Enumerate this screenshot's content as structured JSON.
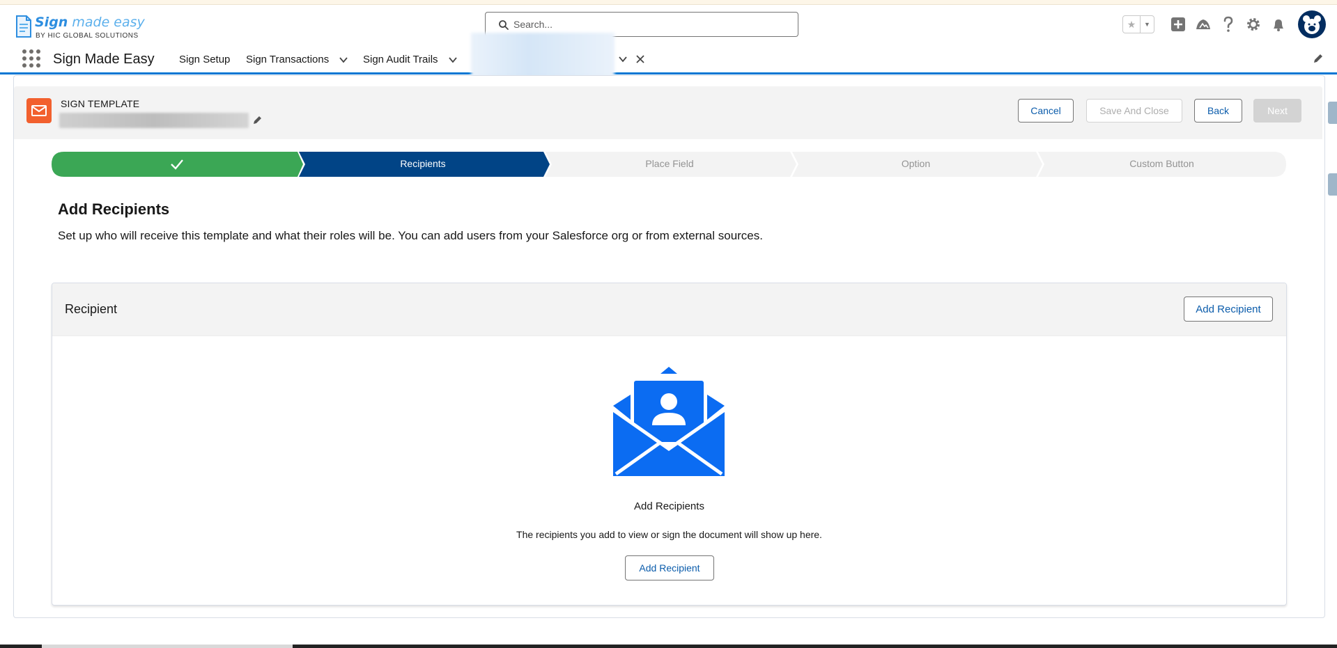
{
  "brand": {
    "logo_main": "Sign",
    "logo_main_rest": " made easy",
    "logo_sub": "BY HIC GLOBAL SOLUTIONS",
    "accent": "#0176d3"
  },
  "search": {
    "placeholder": "Search..."
  },
  "header_icons": [
    "star-icon",
    "chevron-down-icon",
    "add-icon",
    "trailhead-icon",
    "help-icon",
    "gear-icon",
    "bell-icon",
    "avatar"
  ],
  "nav": {
    "app_name": "Sign Made Easy",
    "items": [
      {
        "label": "Sign Setup"
      },
      {
        "label": "Sign Transactions"
      },
      {
        "label": "Sign Audit Trails"
      }
    ]
  },
  "record": {
    "object_label": "SIGN TEMPLATE",
    "icon_color": "#f2602e"
  },
  "actions": {
    "cancel": "Cancel",
    "save_close": "Save And Close",
    "back": "Back",
    "next": "Next"
  },
  "path": {
    "steps": [
      {
        "label": "",
        "state": "complete",
        "color": "#3ba755"
      },
      {
        "label": "Recipients",
        "state": "current",
        "color": "#014486"
      },
      {
        "label": "Place Field",
        "state": "incomplete",
        "color": "#f3f3f3"
      },
      {
        "label": "Option",
        "state": "incomplete",
        "color": "#f3f3f3"
      },
      {
        "label": "Custom Button",
        "state": "incomplete",
        "color": "#f3f3f3"
      }
    ]
  },
  "content": {
    "title": "Add Recipients",
    "description": "Set up who will receive this template and what their roles will be. You can add users from your Salesforce org or from external sources."
  },
  "recipient_card": {
    "title": "Recipient",
    "add_button": "Add Recipient",
    "empty_title": "Add Recipients",
    "empty_desc": "The recipients you add to view or sign the document will show up here.",
    "empty_button": "Add Recipient",
    "illustration_color": "#0b6cf2"
  }
}
